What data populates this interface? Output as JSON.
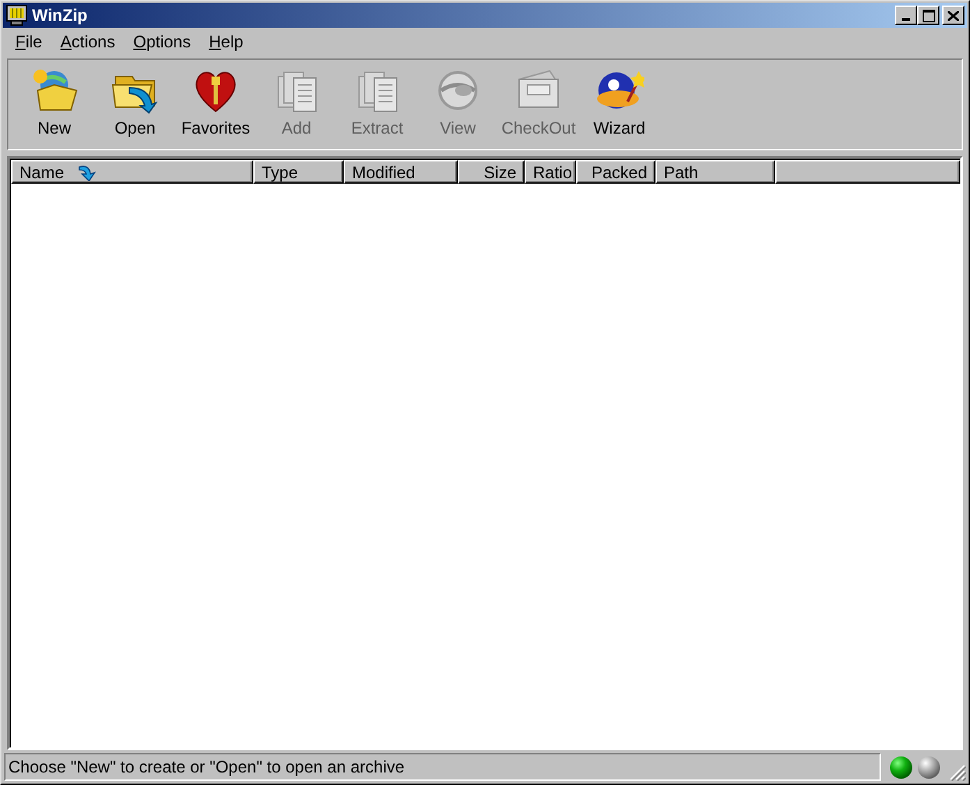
{
  "window": {
    "title": "WinZip"
  },
  "menu": [
    {
      "label": "File"
    },
    {
      "label": "Actions"
    },
    {
      "label": "Options"
    },
    {
      "label": "Help"
    }
  ],
  "toolbar": [
    {
      "label": "New",
      "disabled": false
    },
    {
      "label": "Open",
      "disabled": false
    },
    {
      "label": "Favorites",
      "disabled": false
    },
    {
      "label": "Add",
      "disabled": true
    },
    {
      "label": "Extract",
      "disabled": true
    },
    {
      "label": "View",
      "disabled": true
    },
    {
      "label": "CheckOut",
      "disabled": true
    },
    {
      "label": "Wizard",
      "disabled": false
    }
  ],
  "table": {
    "columns": [
      {
        "label": "Name",
        "sorted": true
      },
      {
        "label": "Type",
        "sorted": false
      },
      {
        "label": "Modified",
        "sorted": false
      },
      {
        "label": "Size",
        "sorted": false
      },
      {
        "label": "Ratio",
        "sorted": false
      },
      {
        "label": "Packed",
        "sorted": false
      },
      {
        "label": "Path",
        "sorted": false
      }
    ]
  },
  "status_bar": {
    "text": "Choose \"New\" to create or \"Open\" to open an archive",
    "lights": [
      {
        "on": true
      },
      {
        "on": false
      }
    ]
  }
}
